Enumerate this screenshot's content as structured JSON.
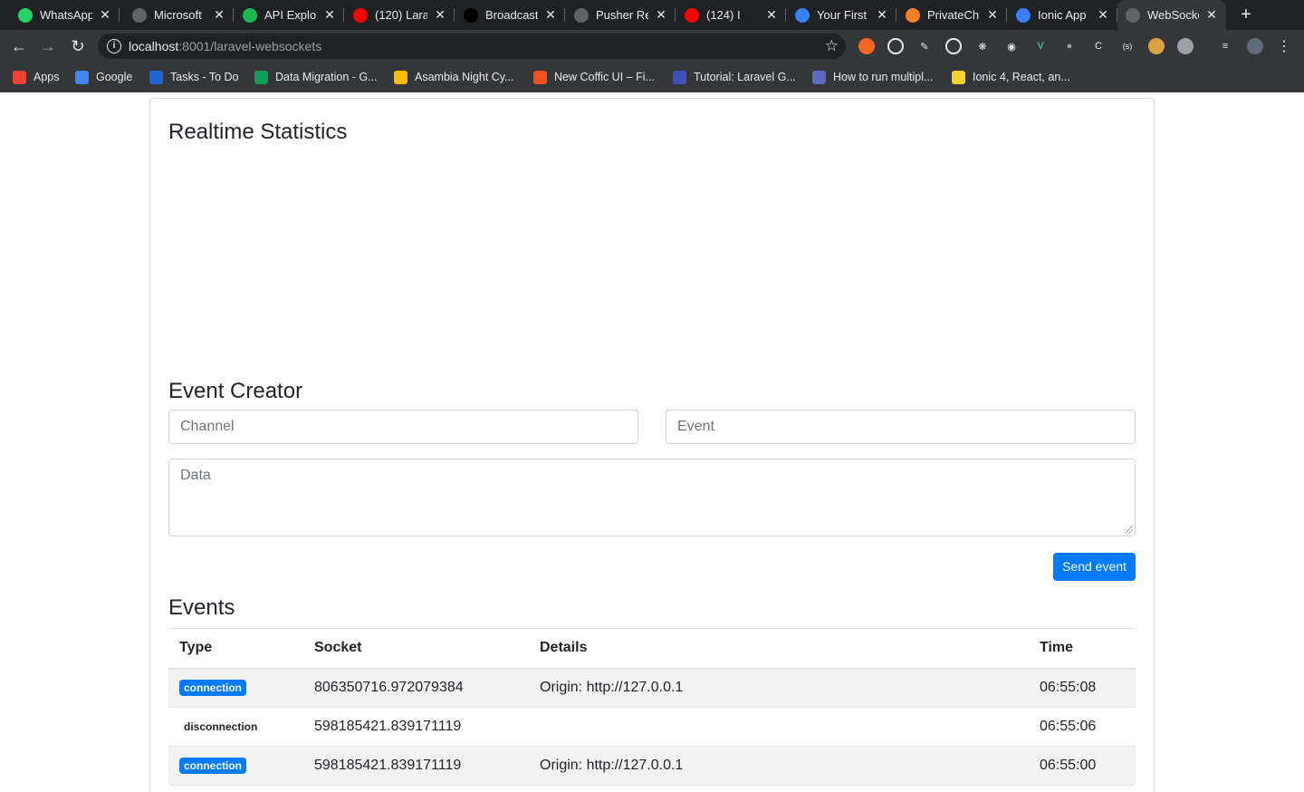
{
  "tabs": [
    {
      "title": "WhatsApp",
      "icon": "whatsapp-icon",
      "color": "#25d366"
    },
    {
      "title": "Microsoft",
      "icon": "globe-icon",
      "color": "#5f6368"
    },
    {
      "title": "API Explor",
      "icon": "api-explorer-icon",
      "color": "#1db954"
    },
    {
      "title": "(120) Lara",
      "icon": "youtube-icon",
      "color": "#ff0000"
    },
    {
      "title": "Broadcast",
      "icon": "medium-icon",
      "color": "#000000"
    },
    {
      "title": "Pusher Re",
      "icon": "globe-icon",
      "color": "#5f6368"
    },
    {
      "title": "(124) I",
      "icon": "youtube-icon",
      "color": "#ff0000"
    },
    {
      "title": "Your First",
      "icon": "ionic-icon",
      "color": "#3880ff"
    },
    {
      "title": "PrivateCh",
      "icon": "stackoverflow-icon",
      "color": "#f48024"
    },
    {
      "title": "Ionic App",
      "icon": "ionic-icon",
      "color": "#3880ff"
    },
    {
      "title": "WebSocke",
      "icon": "globe-icon",
      "color": "#5f6368"
    }
  ],
  "address_bar": {
    "host": "localhost",
    "path": ":8001/laravel-websockets"
  },
  "bookmarks": [
    {
      "label": "Apps",
      "icon": "apps-grid-icon",
      "color": "#ea4335"
    },
    {
      "label": "Google",
      "icon": "google-icon",
      "color": "#4285f4"
    },
    {
      "label": "Tasks - To Do",
      "icon": "checkmark-icon",
      "color": "#2564cf"
    },
    {
      "label": "Data Migration - G...",
      "icon": "sheets-icon",
      "color": "#0f9d58"
    },
    {
      "label": "Asambia Night Cy...",
      "icon": "drive-icon",
      "color": "#fbbc04"
    },
    {
      "label": "New Coffic UI – Fi...",
      "icon": "figma-icon",
      "color": "#f24e1e"
    },
    {
      "label": "Tutorial: Laravel G...",
      "icon": "bluetooth-icon",
      "color": "#3f51b5"
    },
    {
      "label": "How to run multipl...",
      "icon": "link-icon",
      "color": "#5c6bc0"
    },
    {
      "label": "Ionic 4, React, an...",
      "icon": "python-icon",
      "color": "#f7d22c"
    }
  ],
  "main": {
    "stats_title": "Realtime Statistics",
    "creator_title": "Event Creator",
    "channel_placeholder": "Channel",
    "event_placeholder": "Event",
    "data_placeholder": "Data",
    "send_label": "Send event",
    "events_title": "Events",
    "columns": [
      "Type",
      "Socket",
      "Details",
      "Time"
    ],
    "rows": [
      {
        "type": "connection",
        "socket": "806350716.972079384",
        "details": "Origin: http://127.0.0.1",
        "time": "06:55:08"
      },
      {
        "type": "disconnection",
        "socket": "598185421.839171119",
        "details": "",
        "time": "06:55:06"
      },
      {
        "type": "connection",
        "socket": "598185421.839171119",
        "details": "Origin: http://127.0.0.1",
        "time": "06:55:00"
      }
    ]
  }
}
